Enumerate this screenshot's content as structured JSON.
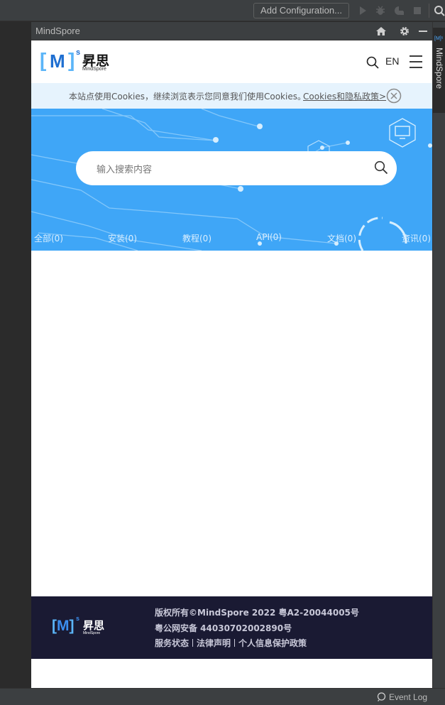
{
  "ide": {
    "add_configuration": "Add Configuration...",
    "tool_window_title": "MindSpore",
    "right_stripe_label": "MindSpore",
    "right_stripe_logo": "[M]ˢ",
    "event_log": "Event Log"
  },
  "site": {
    "logo_cn": "昇思",
    "logo_en": "MindSpore",
    "lang": "EN",
    "cookie_text": "本站点使用Cookies，继续浏览表示您同意我们使用Cookies。",
    "cookie_link": "Cookies和隐私政策>",
    "search_placeholder": "输入搜索内容",
    "tabs": [
      "全部(0)",
      "安装(0)",
      "教程(0)",
      "API(0)",
      "文档(0)",
      "资讯(0)"
    ],
    "footer": {
      "line1": "版权所有©MindSpore 2022   粤A2-20044005号",
      "line2": "粤公网安备   44030702002890号",
      "link_status": "服务状态",
      "link_legal": "法律声明",
      "link_privacy": "个人信息保护政策"
    }
  },
  "colors": {
    "ide_bg": "#2b2b2b",
    "ide_panel": "#3c3f41",
    "hero_blue": "#3fa6f7",
    "cookie_bg": "#e6f3fd",
    "footer_bg": "#1a1a33"
  }
}
